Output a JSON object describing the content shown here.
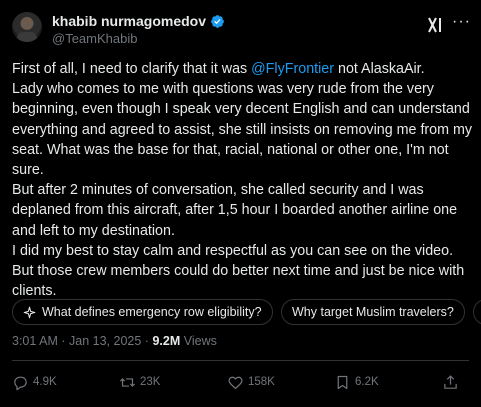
{
  "author": {
    "display_name": "khabib nurmagomedov",
    "handle": "@TeamKhabib"
  },
  "tweet": {
    "pre": "First of all, I need to clarify that it was ",
    "mention": "@FlyFrontier",
    "post": " not AlaskaAir.\nLady who comes to me with questions was very rude from the very beginning, even though I speak very decent English and can understand everything and agreed to assist, she still insists on removing me from my seat. What was the base for that, racial, national or other one, I'm not sure.\nBut after 2 minutes of conversation, she called security and I was deplaned from this aircraft, after 1,5 hour I boarded another airline one and left to my destination.\nI did my best to stay calm and respectful as you can see on the video. But those crew members could do better next time and just be nice with clients."
  },
  "chips": [
    {
      "label": "What defines emergency row eligibility?"
    },
    {
      "label": "Why target Muslim travelers?"
    }
  ],
  "meta": {
    "time": "3:01 AM",
    "separator": "·",
    "date": "Jan 13, 2025",
    "views_count": "9.2M",
    "views_label": "Views"
  },
  "actions": {
    "replies": "4.9K",
    "reposts": "23K",
    "likes": "158K",
    "bookmarks": "6.2K"
  },
  "colors": {
    "background": "#000000",
    "text": "#e7e9ea",
    "secondary": "#71767b",
    "accent": "#1d9bf0",
    "border": "#2f3336"
  },
  "icons": [
    "verified-badge-icon",
    "grok-icon",
    "more-icon",
    "sparkle-icon",
    "reply-icon",
    "repost-icon",
    "like-icon",
    "bookmark-icon",
    "share-icon"
  ]
}
